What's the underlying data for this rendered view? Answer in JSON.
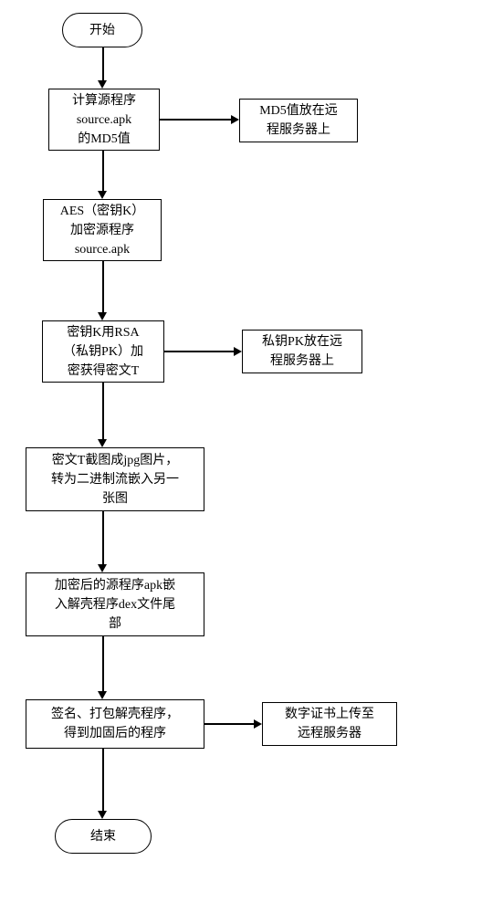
{
  "chart_data": {
    "type": "flowchart",
    "title": "",
    "nodes": [
      {
        "id": "start",
        "kind": "terminator",
        "label": "开始"
      },
      {
        "id": "calcMd5",
        "kind": "process",
        "label": "计算源程序\nsource.apk\n的MD5值"
      },
      {
        "id": "md5Remote",
        "kind": "process",
        "label": "MD5值放在远\n程服务器上"
      },
      {
        "id": "aes",
        "kind": "process",
        "label": "AES（密钥K）\n加密源程序\nsource.apk"
      },
      {
        "id": "rsa",
        "kind": "process",
        "label": "密钥K用RSA\n（私钥PK）加\n密获得密文T"
      },
      {
        "id": "pkRemote",
        "kind": "process",
        "label": "私钥PK放在远\n程服务器上"
      },
      {
        "id": "jpg",
        "kind": "process",
        "label": "密文T截图成jpg图片，\n转为二进制流嵌入另一\n张图"
      },
      {
        "id": "embed",
        "kind": "process",
        "label": "加密后的源程序apk嵌\n入解壳程序dex文件尾\n部"
      },
      {
        "id": "sign",
        "kind": "process",
        "label": "签名、打包解壳程序，\n得到加固后的程序"
      },
      {
        "id": "certRemote",
        "kind": "process",
        "label": "数字证书上传至\n远程服务器"
      },
      {
        "id": "end",
        "kind": "terminator",
        "label": "结束"
      }
    ],
    "edges": [
      {
        "from": "start",
        "to": "calcMd5"
      },
      {
        "from": "calcMd5",
        "to": "md5Remote"
      },
      {
        "from": "calcMd5",
        "to": "aes"
      },
      {
        "from": "aes",
        "to": "rsa"
      },
      {
        "from": "rsa",
        "to": "pkRemote"
      },
      {
        "from": "rsa",
        "to": "jpg"
      },
      {
        "from": "jpg",
        "to": "embed"
      },
      {
        "from": "embed",
        "to": "sign"
      },
      {
        "from": "sign",
        "to": "certRemote"
      },
      {
        "from": "sign",
        "to": "end"
      }
    ]
  }
}
